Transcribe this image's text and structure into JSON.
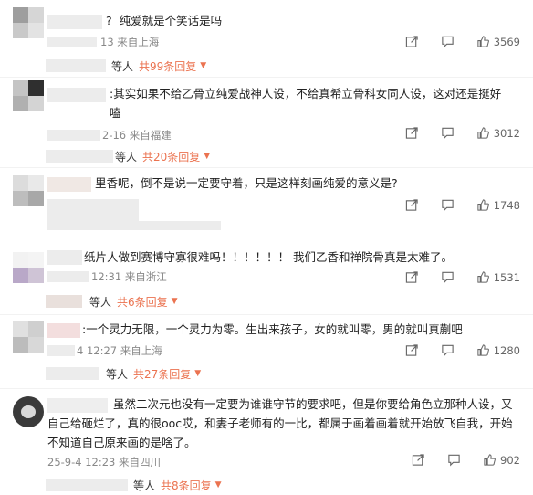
{
  "comments": [
    {
      "text": "?  纯爱就是个笑话是吗",
      "time": "13",
      "loc": "来自上海",
      "likes": "3569",
      "reply_who": "等人",
      "reply_count": "共99条回复"
    },
    {
      "text": ":其实如果不给乙骨立纯爱战神人设，不给真希立骨科女同人设，这对还是挺好嗑",
      "time": "2-16",
      "loc": "来自福建",
      "likes": "3012",
      "reply_who": "等人",
      "reply_count": "共20条回复"
    },
    {
      "text": "里香呢，倒不是说一定要守着，只是这样刻画纯爱的意义是?",
      "time": "",
      "loc": "",
      "likes": "1748",
      "reply_who": "",
      "reply_count": ""
    },
    {
      "text": "纸片人做到赛博守寡很难吗！！！！！！ 我们乙香和禅院骨真是太难了。",
      "time": "12:31",
      "loc": "来自浙江",
      "likes": "1531",
      "reply_who": "等人",
      "reply_count": "共6条回复"
    },
    {
      "text": ":一个灵力无限，一个灵力为零。生出来孩子，女的就叫零，男的就叫真蒯吧",
      "time": "4 12:27",
      "loc": "来自上海",
      "likes": "1280",
      "reply_who": "等人",
      "reply_count": "共27条回复"
    },
    {
      "text": "虽然二次元也没有一定要为谁谁守节的要求吧，但是你要给角色立那种人设，又自己给砸烂了，真的很ooc哎，和妻子老师有的一比，都属于画着画着就开始放飞自我，开始不知道自己原来画的是啥了。",
      "time": "25-9-4 12:23",
      "loc": "来自四川",
      "likes": "902",
      "reply_who": "等人",
      "reply_count": "共8条回复"
    }
  ],
  "icons": {
    "share": "share-icon",
    "comment": "comment-icon",
    "like": "thumbs-up-icon",
    "expand": "chevron-down-icon"
  },
  "colors": {
    "accent": "#eb7350",
    "meta": "#888888"
  }
}
